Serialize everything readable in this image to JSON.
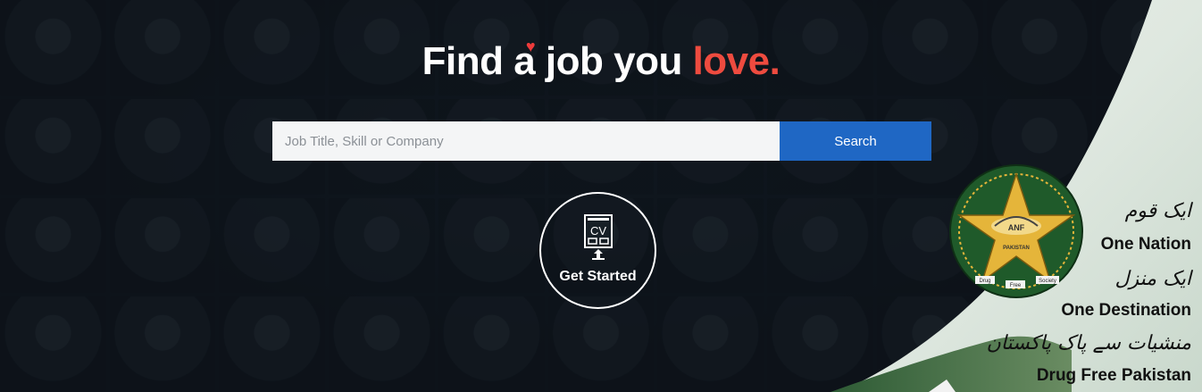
{
  "headline": {
    "part1": "Find a ",
    "part2": "job you ",
    "accent": "love."
  },
  "search": {
    "placeholder": "Job Title, Skill or Company",
    "button_label": "Search"
  },
  "cta": {
    "icon_text": "CV",
    "label": "Get Started"
  },
  "banner": {
    "emblem": {
      "top_text": "ANF",
      "bottom_left": "Drug",
      "bottom_mid": "Free",
      "bottom_right": "Society",
      "country": "PAKISTAN"
    },
    "lines": [
      {
        "urdu": "ایک قوم",
        "english": "One Nation"
      },
      {
        "urdu": "ایک منزل",
        "english": "One Destination"
      },
      {
        "urdu": "منشیات سے پاک پاکستان",
        "english": "Drug Free Pakistan"
      }
    ]
  },
  "colors": {
    "accent_red": "#ee4b3f",
    "search_blue": "#1f67c4",
    "emblem_green": "#1f5a2a",
    "emblem_gold": "#e5b53a"
  }
}
